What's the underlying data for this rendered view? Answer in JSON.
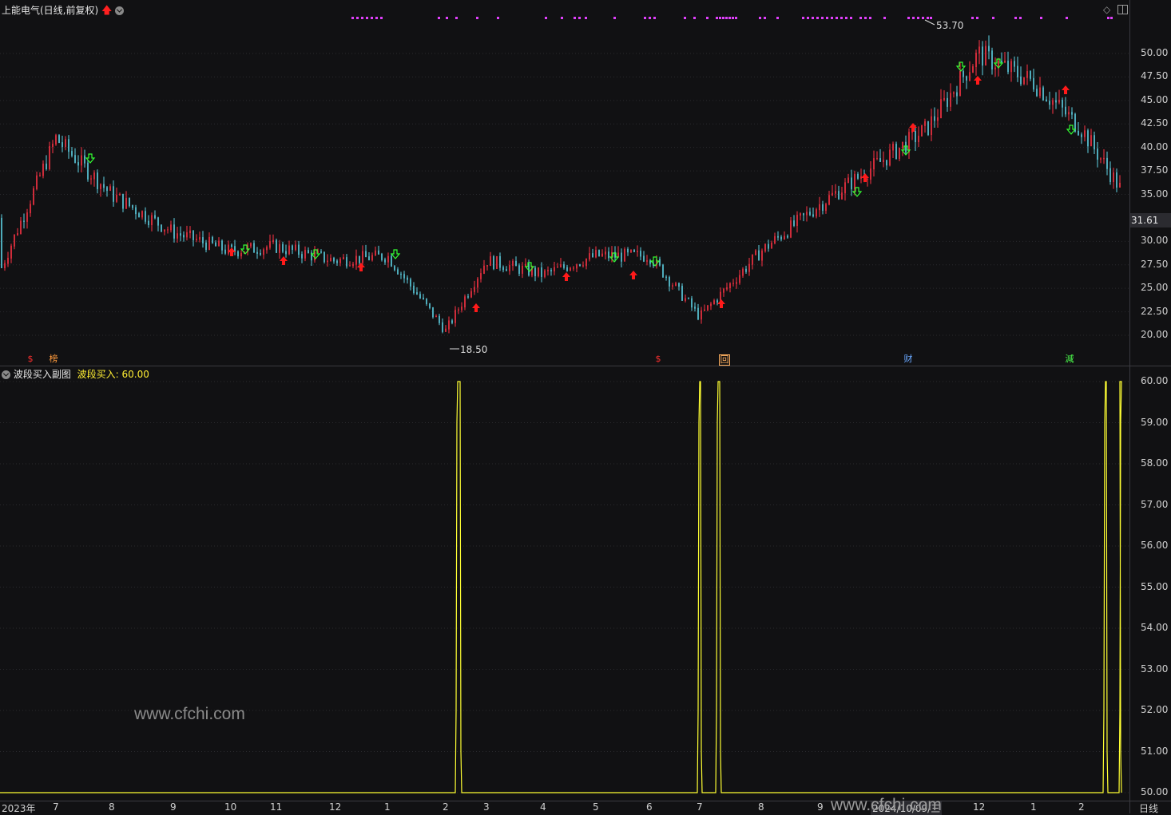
{
  "header": {
    "title": "上能电气(日线,前复权)",
    "up_icon": "red-up-arrow-icon",
    "menu_icon": "chevron-down-circle-icon",
    "right_icons": [
      "diamond-icon",
      "panel-toggle-icon"
    ]
  },
  "main_chart": {
    "y_ticks": [
      "50.00",
      "47.50",
      "45.00",
      "42.50",
      "40.00",
      "37.50",
      "35.00",
      "30.00",
      "27.50",
      "25.00",
      "22.50",
      "20.00"
    ],
    "current_price": "31.61",
    "high_label": "53.70",
    "low_label": "18.50",
    "event_badges": [
      {
        "text": "$",
        "color": "#ff3030"
      },
      {
        "text": "榜",
        "color": "#ff9a3c"
      },
      {
        "text": "$",
        "color": "#ff3030"
      },
      {
        "text": "回",
        "color": "#ffb060"
      },
      {
        "text": "财",
        "color": "#6aa8ff"
      },
      {
        "text": "減",
        "color": "#4cff4c"
      }
    ],
    "colors": {
      "up": "#ff3344",
      "down": "#5fd3e6",
      "buy": "#ff1a1a",
      "sell": "#33ff33",
      "top_marks": "#e040fb"
    }
  },
  "sub_chart": {
    "title": "波段买入副图",
    "value_label": "波段买入: 60.00",
    "y_ticks": [
      "60.00",
      "59.00",
      "58.00",
      "57.00",
      "56.00",
      "55.00",
      "54.00",
      "53.00",
      "52.00",
      "51.00",
      "50.00"
    ],
    "line_color": "#ffff33"
  },
  "x_axis": {
    "labels": [
      "2023年",
      "7",
      "8",
      "9",
      "10",
      "11",
      "12",
      "1",
      "2",
      "3",
      "4",
      "5",
      "6",
      "7",
      "8",
      "9",
      "2024/10/09/三",
      "12",
      "1",
      "2"
    ],
    "period": "日线"
  },
  "watermarks": [
    "www.cfchi.com",
    "www.cfchi.com"
  ],
  "chart_data": [
    {
      "type": "line",
      "title": "上能电气(日线,前复权)",
      "xlabel": "",
      "ylabel": "",
      "ylim": [
        18,
        54
      ],
      "x": [
        "2023-06",
        "2023-07",
        "2023-08",
        "2023-09",
        "2023-10",
        "2023-11",
        "2023-12",
        "2024-01",
        "2024-02",
        "2024-03",
        "2024-04",
        "2024-05",
        "2024-06",
        "2024-07",
        "2024-08",
        "2024-09",
        "2024-10",
        "2024-11",
        "2024-12",
        "2025-01",
        "2025-02",
        "2025-03"
      ],
      "series": [
        {
          "values": [
            32.5,
            41,
            35,
            31,
            29,
            29.5,
            28,
            28.5,
            20.5,
            28,
            26.5,
            28.5,
            28.5,
            22,
            29,
            34,
            42,
            50,
            47,
            42,
            36,
            33.6
          ]
        }
      ],
      "annotations": [
        "53.70",
        "18.50",
        "31.61"
      ]
    },
    {
      "type": "line",
      "title": "波段买入副图",
      "xlabel": "",
      "ylabel": "",
      "ylim": [
        50,
        60
      ],
      "spikes_at_month": [
        "2024-02",
        "2024-07",
        "2024-07",
        "2025-03",
        "2025-03"
      ],
      "baseline": 50,
      "peak": 60
    }
  ]
}
